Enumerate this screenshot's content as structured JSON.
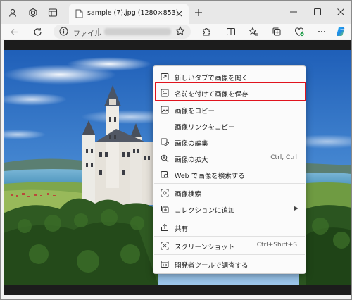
{
  "tab": {
    "title": "sample (7).jpg (1280×853)"
  },
  "address": {
    "file_label": "ファイル"
  },
  "context_menu": {
    "items": [
      {
        "name": "open-in-new-tab",
        "label": "新しいタブで画像を開く",
        "shortcut": "",
        "icon": "new-tab-icon"
      },
      {
        "name": "save-image-as",
        "label": "名前を付けて画像を保存",
        "shortcut": "",
        "icon": "save-image-icon"
      },
      {
        "name": "copy-image",
        "label": "画像をコピー",
        "shortcut": "",
        "icon": "copy-image-icon"
      },
      {
        "name": "copy-image-link",
        "label": "画像リンクをコピー",
        "shortcut": "",
        "icon": ""
      },
      {
        "name": "edit-image",
        "label": "画像の編集",
        "shortcut": "",
        "icon": "edit-image-icon"
      },
      {
        "name": "zoom-image",
        "label": "画像の拡大",
        "shortcut": "Ctrl, Ctrl",
        "icon": "zoom-in-icon"
      },
      {
        "name": "search-web-image",
        "label": "Web で画像を検索する",
        "shortcut": "",
        "icon": "web-search-icon"
      },
      {
        "name": "image-search",
        "label": "画像検索",
        "shortcut": "",
        "icon": "visual-search-icon"
      },
      {
        "name": "add-to-collections",
        "label": "コレクションに追加",
        "shortcut": "",
        "icon": "collections-icon",
        "submenu": true
      },
      {
        "name": "share",
        "label": "共有",
        "shortcut": "",
        "icon": "share-icon"
      },
      {
        "name": "screenshot",
        "label": "スクリーンショット",
        "shortcut": "Ctrl+Shift+S",
        "icon": "screenshot-icon"
      },
      {
        "name": "inspect",
        "label": "開発者ツールで調査する",
        "shortcut": "",
        "icon": "devtools-icon"
      }
    ]
  },
  "colors": {
    "highlight": "#e0141e",
    "menu_bg": "#fbfbfb",
    "viewport_bg": "#1c1c1c"
  }
}
